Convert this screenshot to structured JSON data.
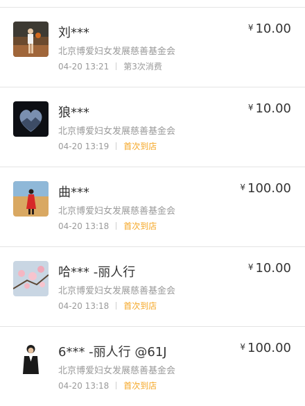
{
  "records": [
    {
      "name": "刘***",
      "org": "北京博爱妇女发展慈善基金会",
      "time": "04-20 13:21",
      "tag": "第3次消费",
      "tag_style": "gray",
      "currency": "¥",
      "amount": "10.00",
      "avatar": "basketball-player-photo"
    },
    {
      "name": "狼***",
      "org": "北京博爱妇女发展慈善基金会",
      "time": "04-20 13:19",
      "tag": "首次到店",
      "tag_style": "orange",
      "currency": "¥",
      "amount": "10.00",
      "avatar": "heart-landscape-photo"
    },
    {
      "name": "曲***",
      "org": "北京博爱妇女发展慈善基金会",
      "time": "04-20 13:18",
      "tag": "首次到店",
      "tag_style": "orange",
      "currency": "¥",
      "amount": "100.00",
      "avatar": "desert-woman-photo"
    },
    {
      "name": "哈*** -丽人行",
      "org": "北京博爱妇女发展慈善基金会",
      "time": "04-20 13:18",
      "tag": "首次到店",
      "tag_style": "orange",
      "currency": "¥",
      "amount": "10.00",
      "avatar": "peach-blossom-photo"
    },
    {
      "name": "6*** -丽人行 @61J",
      "org": "北京博爱妇女发展慈善基金会",
      "time": "04-20 13:18",
      "tag": "首次到店",
      "tag_style": "orange",
      "currency": "¥",
      "amount": "100.00",
      "avatar": "businesswoman-photo"
    }
  ],
  "colors": {
    "tag_orange": "#f5a623",
    "text_gray": "#9a9a9a",
    "divider": "#e4e4e4"
  }
}
